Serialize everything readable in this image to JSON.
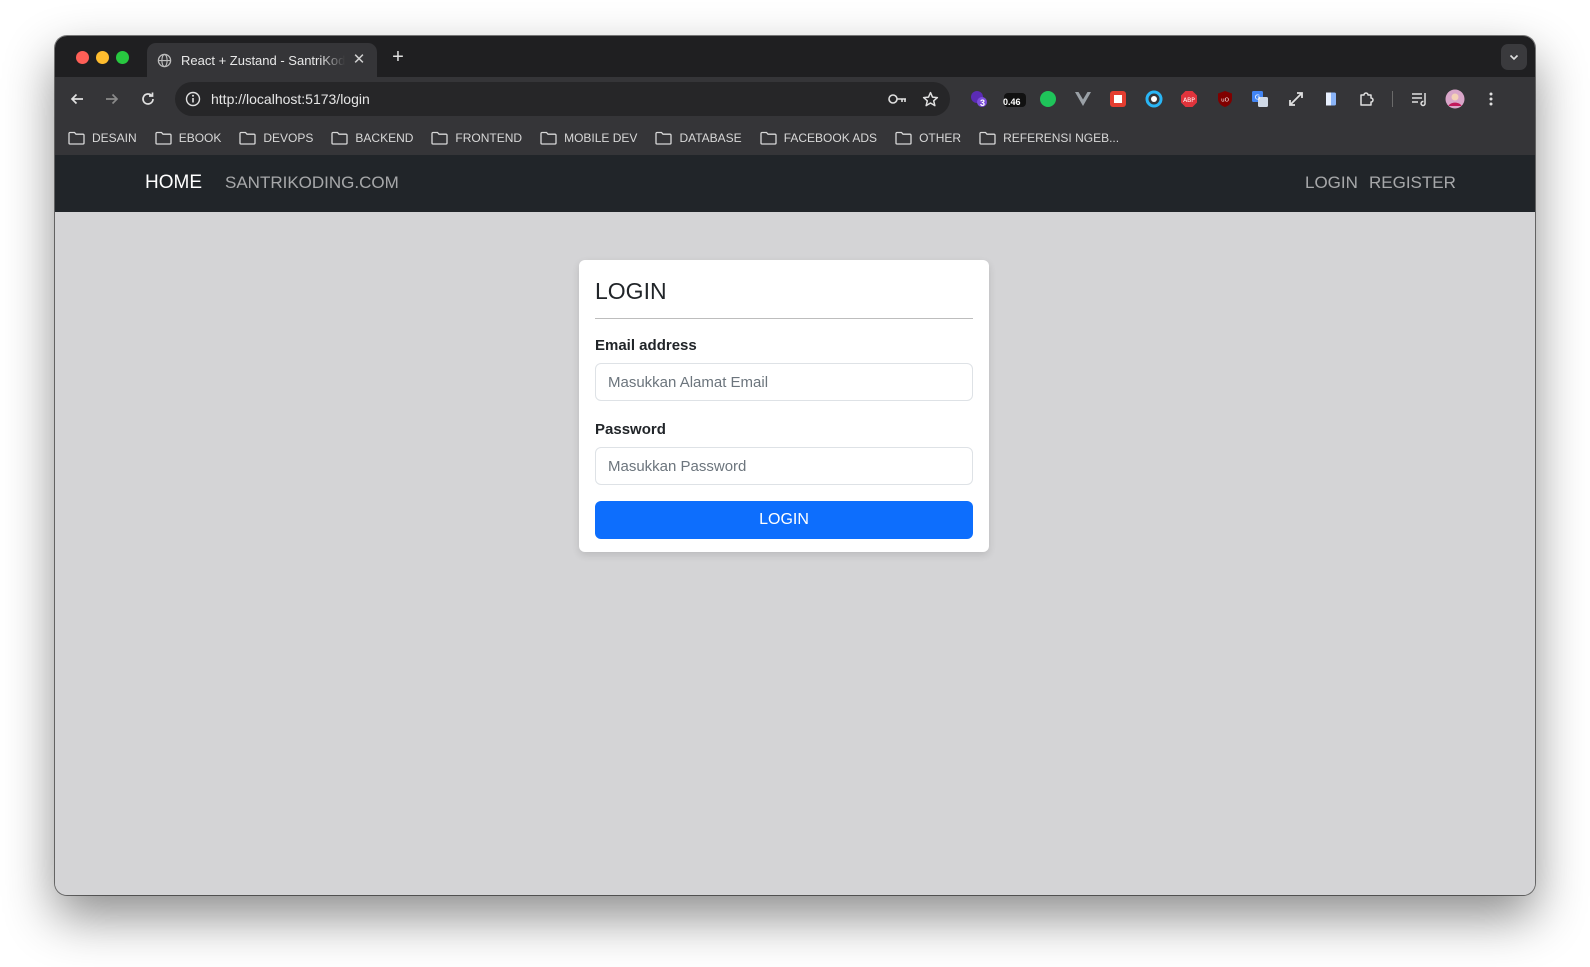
{
  "browser": {
    "tab_title": "React + Zustand - SantriKoding",
    "new_tab_symbol": "+",
    "close_symbol": "✕",
    "url": "http://localhost:5173/login",
    "extensions": [
      {
        "name": "extension-badge-3",
        "badge": "3"
      },
      {
        "name": "extension-badge-046",
        "badge": "0.46"
      }
    ],
    "bookmarks": [
      "DESAIN",
      "EBOOK",
      "DEVOPS",
      "BACKEND",
      "FRONTEND",
      "MOBILE DEV",
      "DATABASE",
      "FACEBOOK ADS",
      "OTHER",
      "REFERENSI NGEB..."
    ]
  },
  "navbar": {
    "brand": "HOME",
    "link_site": "SANTRIKODING.COM",
    "link_login": "LOGIN",
    "link_register": "REGISTER"
  },
  "login_card": {
    "title": "LOGIN",
    "email_label": "Email address",
    "email_placeholder": "Masukkan Alamat Email",
    "email_value": "",
    "password_label": "Password",
    "password_placeholder": "Masukkan Password",
    "password_value": "",
    "submit_label": "LOGIN"
  },
  "colors": {
    "navbar_bg": "#212529",
    "page_bg": "#d4d4d6",
    "primary": "#0d6efd"
  }
}
